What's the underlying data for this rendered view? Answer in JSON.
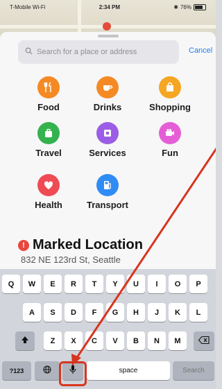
{
  "status_bar": {
    "carrier": "T-Mobile Wi-Fi",
    "time": "2:34 PM",
    "battery": "76%"
  },
  "search": {
    "placeholder": "Search for a place or address",
    "cancel_label": "Cancel"
  },
  "categories": [
    {
      "label": "Food",
      "icon": "fork-knife-icon",
      "color": "#f58a25"
    },
    {
      "label": "Drinks",
      "icon": "coffee-cup-icon",
      "color": "#f58a25"
    },
    {
      "label": "Shopping",
      "icon": "shopping-bag-icon",
      "color": "#f5a623"
    },
    {
      "label": "Travel",
      "icon": "suitcase-icon",
      "color": "#34b24f"
    },
    {
      "label": "Services",
      "icon": "services-icon",
      "color": "#9b5de5"
    },
    {
      "label": "Fun",
      "icon": "camera-icon",
      "color": "#e55ed6"
    },
    {
      "label": "Health",
      "icon": "heart-icon",
      "color": "#ef4b55"
    },
    {
      "label": "Transport",
      "icon": "fuel-icon",
      "color": "#2f8cf5"
    }
  ],
  "marked_location": {
    "title": "Marked Location",
    "address": "832 NE 123rd St, Seattle"
  },
  "keyboard": {
    "row1": [
      "Q",
      "W",
      "E",
      "R",
      "T",
      "Y",
      "U",
      "I",
      "O",
      "P"
    ],
    "row2": [
      "A",
      "S",
      "D",
      "F",
      "G",
      "H",
      "J",
      "K",
      "L"
    ],
    "row3": [
      "Z",
      "X",
      "C",
      "V",
      "B",
      "N",
      "M"
    ],
    "numbers_label": "?123",
    "space_label": "space",
    "search_label": "Search"
  },
  "annotation": {
    "color": "#d8351f",
    "target": "mic-key"
  }
}
